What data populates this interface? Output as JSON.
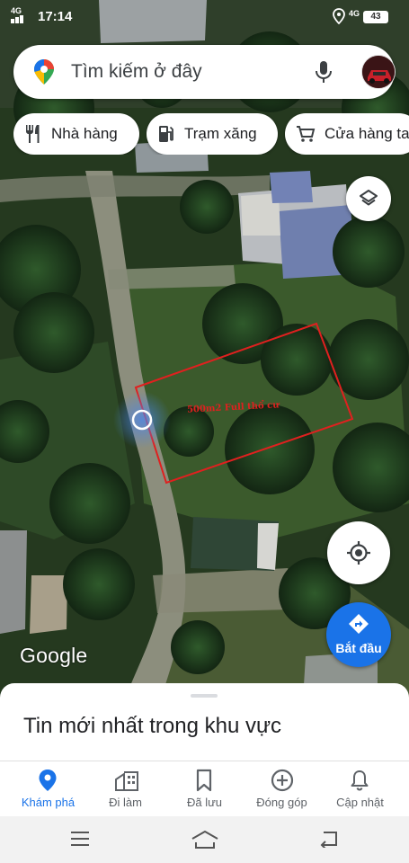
{
  "status_bar": {
    "signal_text": "4G",
    "time": "17:14",
    "network": "4G",
    "battery": "43"
  },
  "search": {
    "placeholder": "Tìm kiếm ở đây",
    "left_icon": "google-maps-pin-icon",
    "mic_icon": "microphone-icon"
  },
  "chips": [
    {
      "label": "Nhà hàng",
      "icon": "restaurant-icon"
    },
    {
      "label": "Trạm xăng",
      "icon": "gas-station-icon"
    },
    {
      "label": "Cửa hàng ta",
      "icon": "shopping-cart-icon"
    }
  ],
  "map": {
    "annotation_label": "500m2 Full thổ cư",
    "annotation_color": "#e0201f",
    "watermark": "Google"
  },
  "buttons": {
    "layers_icon": "layers-icon",
    "locate_icon": "my-location-icon",
    "start_label": "Bắt đầu"
  },
  "sheet": {
    "title": "Tin mới nhất trong khu vực"
  },
  "bottom_nav": [
    {
      "label": "Khám phá",
      "icon": "explore-pin-icon",
      "active": true
    },
    {
      "label": "Đi làm",
      "icon": "commute-icon",
      "active": false
    },
    {
      "label": "Đã lưu",
      "icon": "bookmark-icon",
      "active": false
    },
    {
      "label": "Đóng góp",
      "icon": "add-circle-icon",
      "active": false
    },
    {
      "label": "Cập nhật",
      "icon": "bell-icon",
      "active": false
    }
  ],
  "colors": {
    "accent": "#1a73e8",
    "annotation": "#e0201f"
  }
}
